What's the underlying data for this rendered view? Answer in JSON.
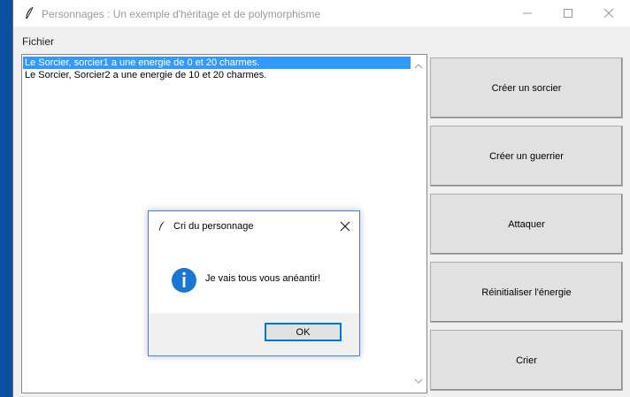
{
  "window": {
    "title": "Personnages : Un exemple d'héritage et de polymorphisme",
    "feather_icon": "tk-feather-icon",
    "controls": [
      "minimize",
      "maximize",
      "close"
    ]
  },
  "menu": {
    "items": [
      {
        "label": "Fichier"
      }
    ]
  },
  "listbox": {
    "items": [
      {
        "text": "Le Sorcier, sorcier1 a une energie de 0 et 20 charmes.",
        "selected": true
      },
      {
        "text": "Le Sorcier, Sorcier2 a une energie de 10 et 20 charmes.",
        "selected": false
      }
    ],
    "selection_color": "#3399ff"
  },
  "buttons": [
    {
      "label": "Créer un sorcier"
    },
    {
      "label": "Créer un guerrier"
    },
    {
      "label": "Attaquer"
    },
    {
      "label": "Réinitialiser l'énergie"
    },
    {
      "label": "Crier"
    }
  ],
  "dialog": {
    "title": "Cri du personnage",
    "message": "Je vais tous vous anéantir!",
    "icon": "info-icon",
    "ok_label": "OK",
    "accent_color": "#0078d7"
  }
}
